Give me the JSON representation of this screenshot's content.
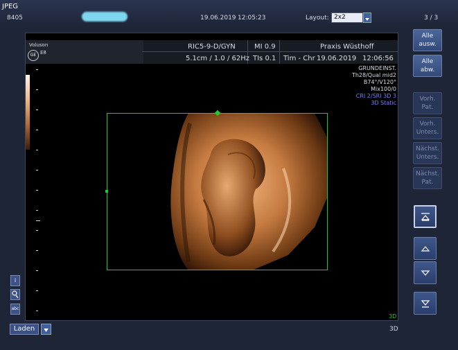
{
  "top": {
    "format": "JPEG",
    "id": "8405",
    "date": "19.06.2019",
    "time": "12:05:23",
    "layout_label": "Layout:",
    "layout_value": "2x2",
    "page": "3 / 3"
  },
  "info": {
    "brand": "Voluson",
    "model": "E8",
    "logo": "GE",
    "probe": "RIC5-9-D/GYN",
    "mi": "MI 0.9",
    "institution": "Praxis Wüsthoff",
    "depth": "5.1cm / 1.0 / 62Hz",
    "tis": "TIs 0.1",
    "operator": "Tim - Chr",
    "date2": "19.06.2019",
    "time2": "12:06:56"
  },
  "params": [
    {
      "text": "GRUNDEINST.",
      "color": "#e6e9f0"
    },
    {
      "text": "Th28/Qual mid2",
      "color": "#e6e9f0"
    },
    {
      "text": "B74°/V120°",
      "color": "#e6e9f0"
    },
    {
      "text": "Mix100/0",
      "color": "#e6e9f0"
    },
    {
      "text": "CRI 2/SRI 3D 3",
      "color": "#6f7dff"
    },
    {
      "text": "3D Static",
      "color": "#6f7dff"
    }
  ],
  "viewport": {
    "mode_label": "3D",
    "roi_color": "#1fcc2a"
  },
  "right_panel": {
    "select_all": "Alle ausw.",
    "deselect_all": "Alle abw.",
    "prev_patient": "Vorh. Pat.",
    "prev_exam": "Vorh. Unters.",
    "next_exam": "Nächst. Unters.",
    "next_patient": "Nächst. Pat."
  },
  "left_panel": {
    "info_icon": "i",
    "search_icon": "search-icon",
    "abc_label": "abc"
  },
  "bottom": {
    "load_label": "Laden",
    "mode": "3D"
  },
  "colors": {
    "background": "#1d2536",
    "button": "#3f578c",
    "roi": "#1fcc2a",
    "accent_blue": "#6f7dff"
  }
}
